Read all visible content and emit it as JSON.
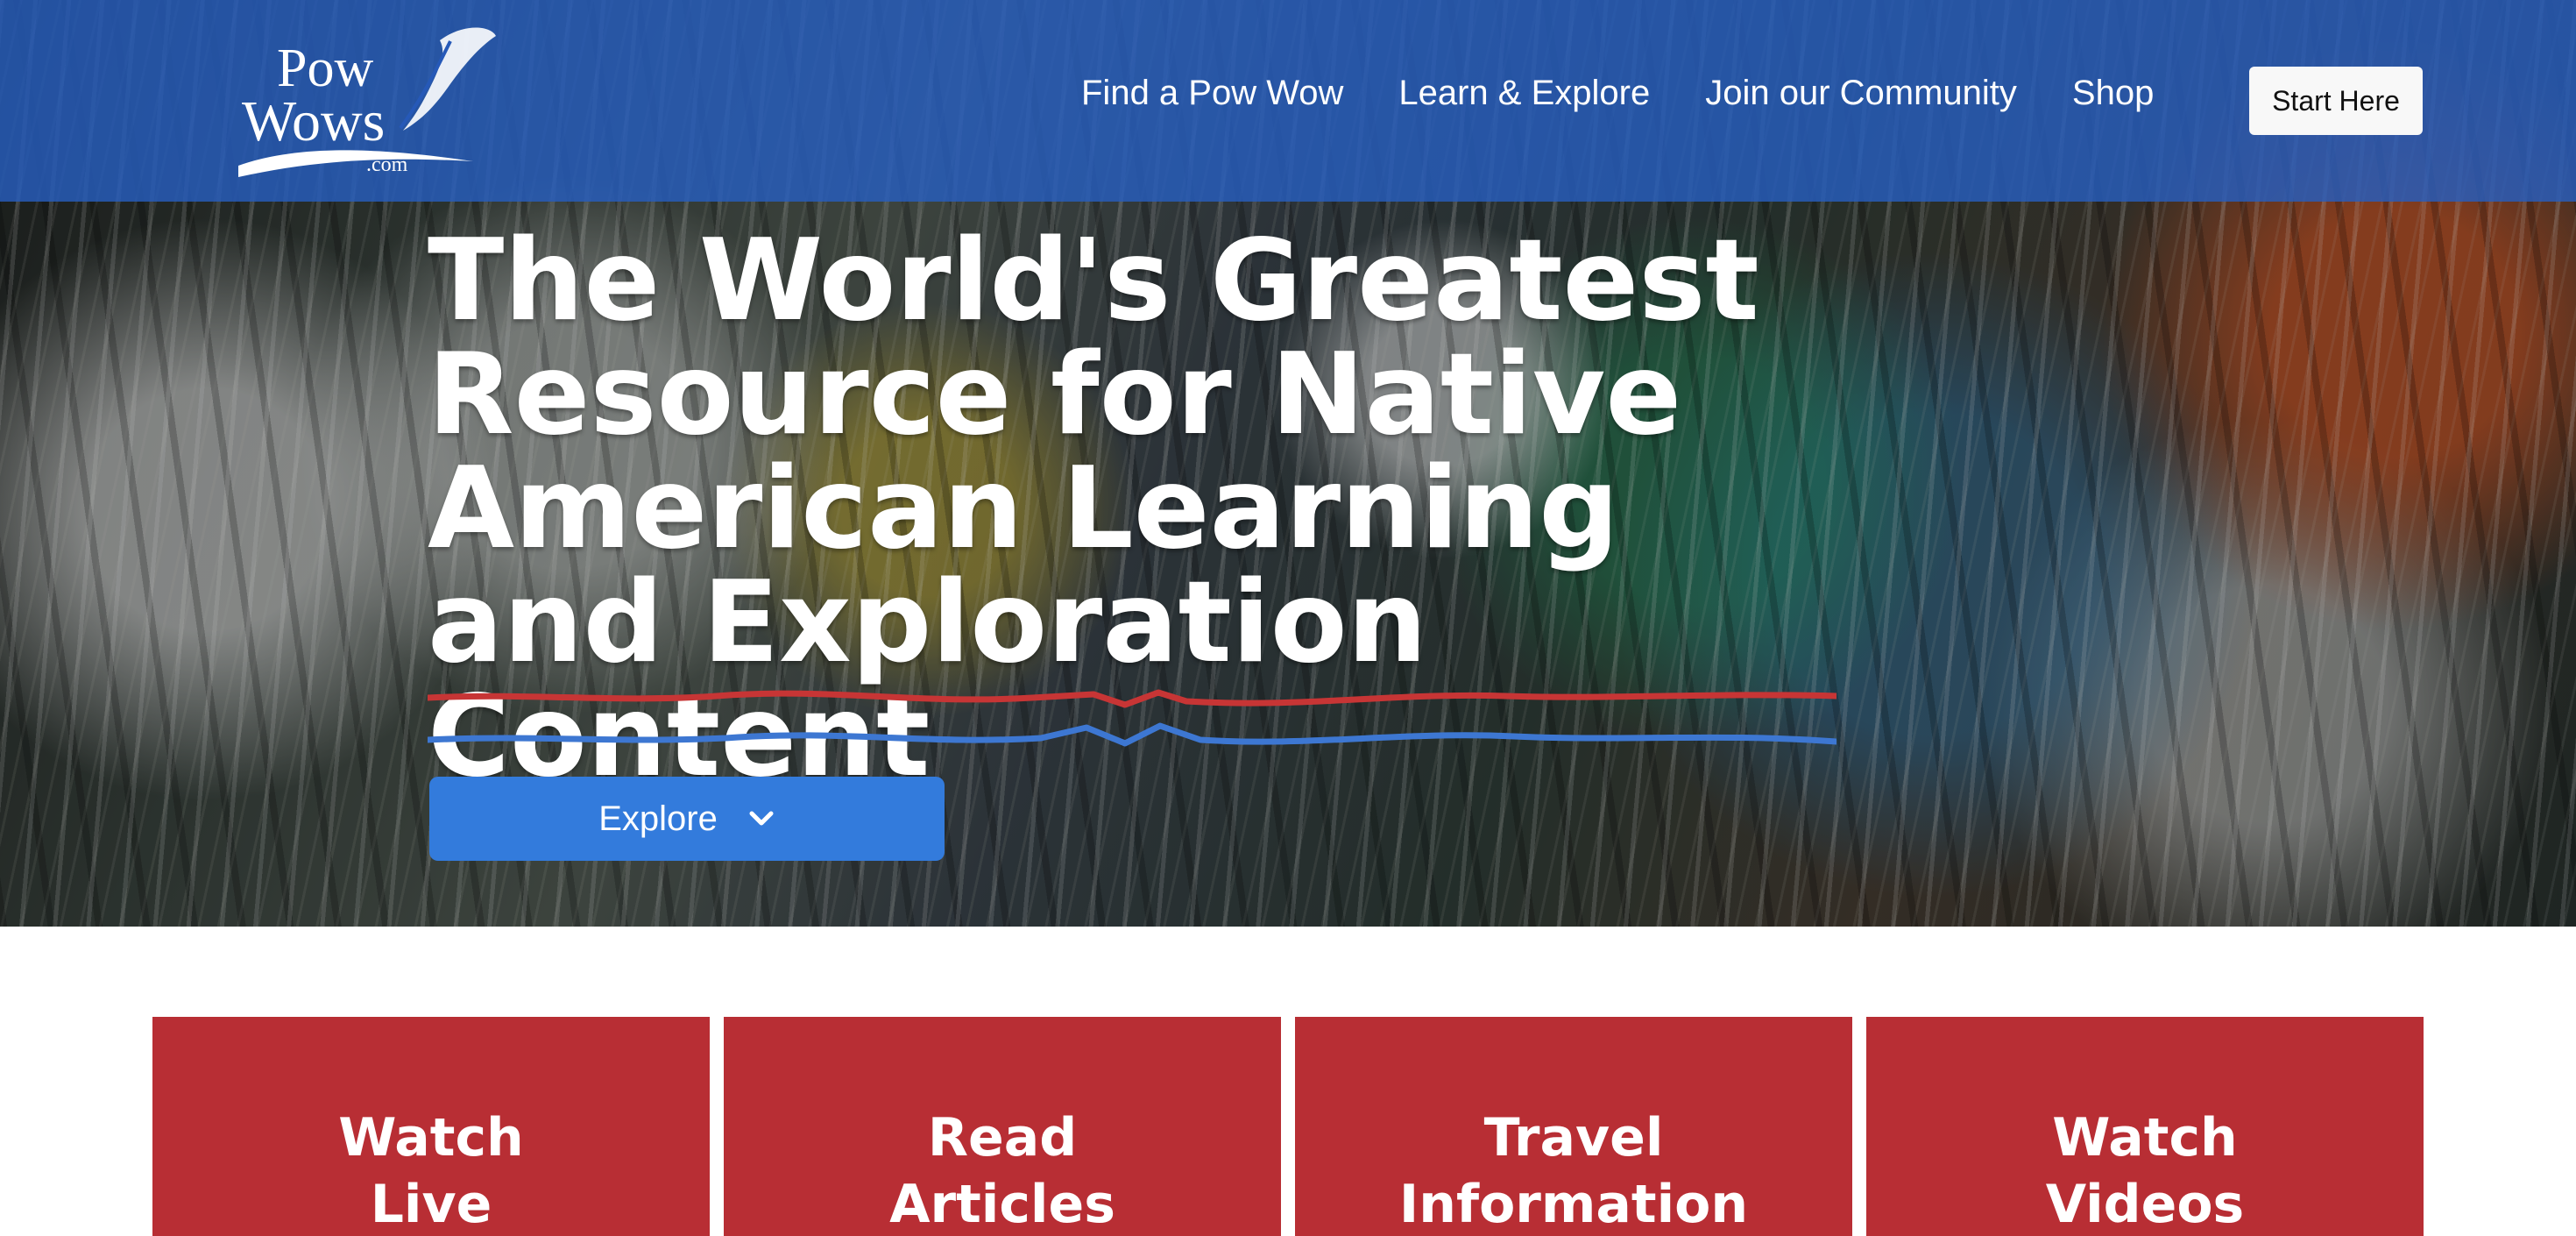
{
  "brand": {
    "line1": "Pow",
    "line2": "Wows",
    "domain": ".com"
  },
  "nav": {
    "items": [
      {
        "label": "Find a Pow Wow"
      },
      {
        "label": "Learn & Explore"
      },
      {
        "label": "Join our Community"
      },
      {
        "label": "Shop"
      }
    ],
    "start_label": "Start Here"
  },
  "hero": {
    "title": "The World's Greatest Resource for Native American Learning and Exploration Content",
    "explore_label": "Explore",
    "explore_icon": "chevron-down-icon"
  },
  "cards": [
    {
      "label": "Watch\nLive"
    },
    {
      "label": "Read\nArticles"
    },
    {
      "label": "Travel\nInformation"
    },
    {
      "label": "Watch\nVideos"
    }
  ],
  "colors": {
    "nav": "#275ebe",
    "accent_blue": "#337bdc",
    "accent_red": "#b82e34",
    "divider_red": "#c73535",
    "divider_blue": "#3d77d2"
  }
}
